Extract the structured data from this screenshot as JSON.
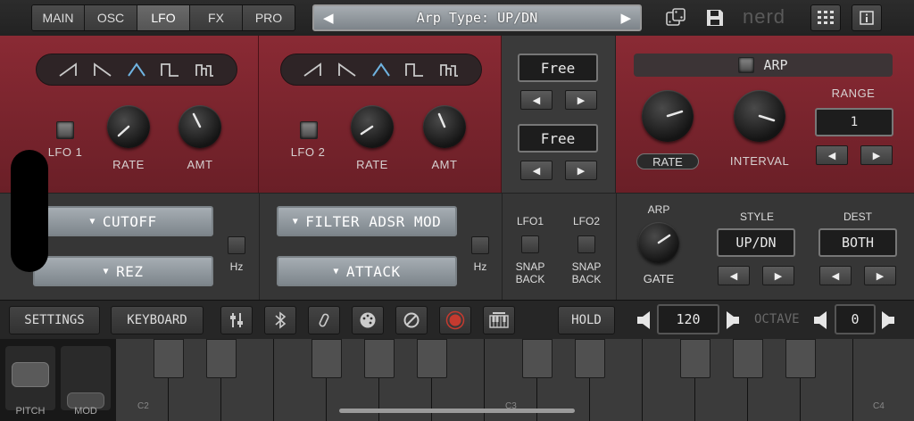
{
  "tabs": [
    "MAIN",
    "OSC",
    "LFO",
    "FX",
    "PRO"
  ],
  "active_tab": "LFO",
  "preset": {
    "text": "Arp Type: UP/DN"
  },
  "brand": "nerd",
  "lfo1": {
    "led_label": "LFO 1",
    "knob1": "RATE",
    "knob2": "AMT",
    "dest1": "CUTOFF",
    "dest2": "REZ",
    "hz": "Hz"
  },
  "lfo2": {
    "led_label": "LFO 2",
    "knob1": "RATE",
    "knob2": "AMT",
    "dest1": "FILTER ADSR MOD",
    "dest2": "ATTACK",
    "hz": "Hz"
  },
  "free": [
    "Free",
    "Free"
  ],
  "snap": {
    "lfo1": "LFO1",
    "lfo2": "LFO2",
    "snap_back": [
      "SNAP",
      "BACK"
    ]
  },
  "arp": {
    "title": "ARP",
    "rate": "RATE",
    "interval": "INTERVAL",
    "range_label": "RANGE",
    "range_value": "1",
    "gate_title": "ARP",
    "gate": "GATE",
    "style_label": "STYLE",
    "style_value": "UP/DN",
    "dest_label": "DEST",
    "dest_value": "BOTH"
  },
  "toolbar": {
    "settings": "SETTINGS",
    "keyboard": "KEYBOARD",
    "hold": "HOLD",
    "tempo": "120",
    "octave_label": "OCTAVE",
    "octave_value": "0"
  },
  "icons": [
    "mixer-icon",
    "bluetooth-icon",
    "link-icon",
    "palette-icon",
    "cancel-icon",
    "record-icon",
    "piano-icon",
    "dice-icon",
    "save-icon",
    "grid-icon",
    "info-icon"
  ],
  "keyboard": {
    "labels": [
      "C2",
      "C3",
      "C4"
    ],
    "pitch": "PITCH",
    "mod": "MOD"
  },
  "colors": {
    "panel_red": "#8a2a34",
    "accent_blue": "#6fb3e0",
    "record_red": "#c43a2f"
  }
}
